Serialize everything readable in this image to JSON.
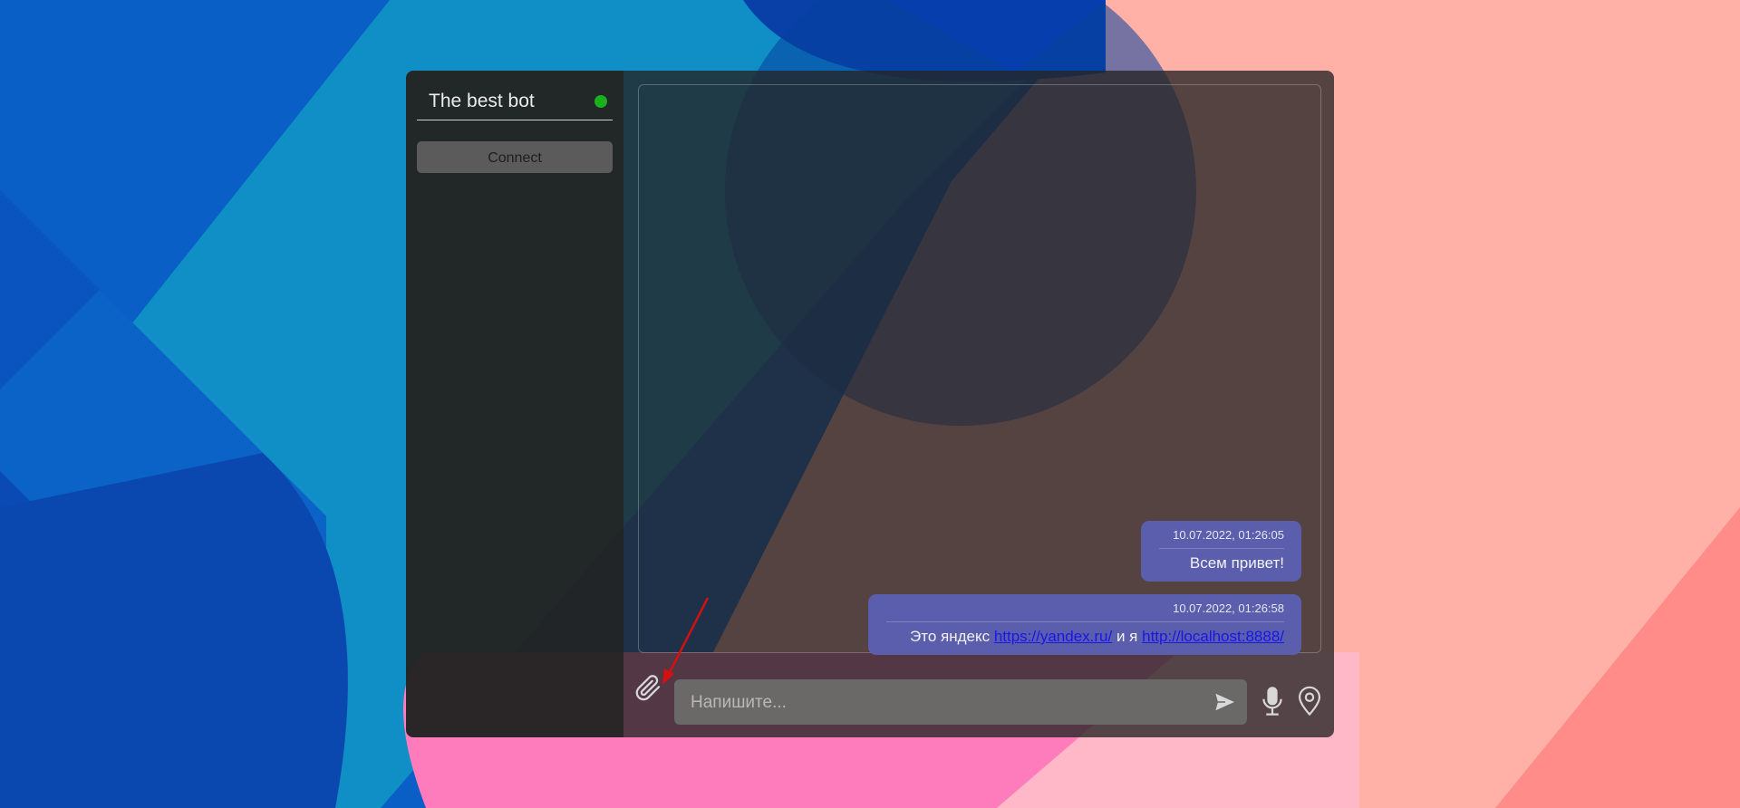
{
  "colors": {
    "accent_online": "#19b01d",
    "message_bubble": "#5b5ead",
    "link": "#1717e6",
    "annotation_arrow": "#d41010"
  },
  "sidebar": {
    "bot_name": "The best bot",
    "status": "online",
    "connect_label": "Connect"
  },
  "messages": [
    {
      "timestamp": "10.07.2022, 01:26:05",
      "text": "Всем привет!"
    },
    {
      "timestamp": "10.07.2022, 01:26:58",
      "text_before": "Это яндекс ",
      "link1": "https://yandex.ru/",
      "text_middle": " и я ",
      "link2": "http://localhost:8888/"
    }
  ],
  "composer": {
    "placeholder": "Напишите...",
    "icons": [
      "paperclip-icon",
      "send-icon",
      "microphone-icon",
      "map-pin-icon"
    ]
  }
}
